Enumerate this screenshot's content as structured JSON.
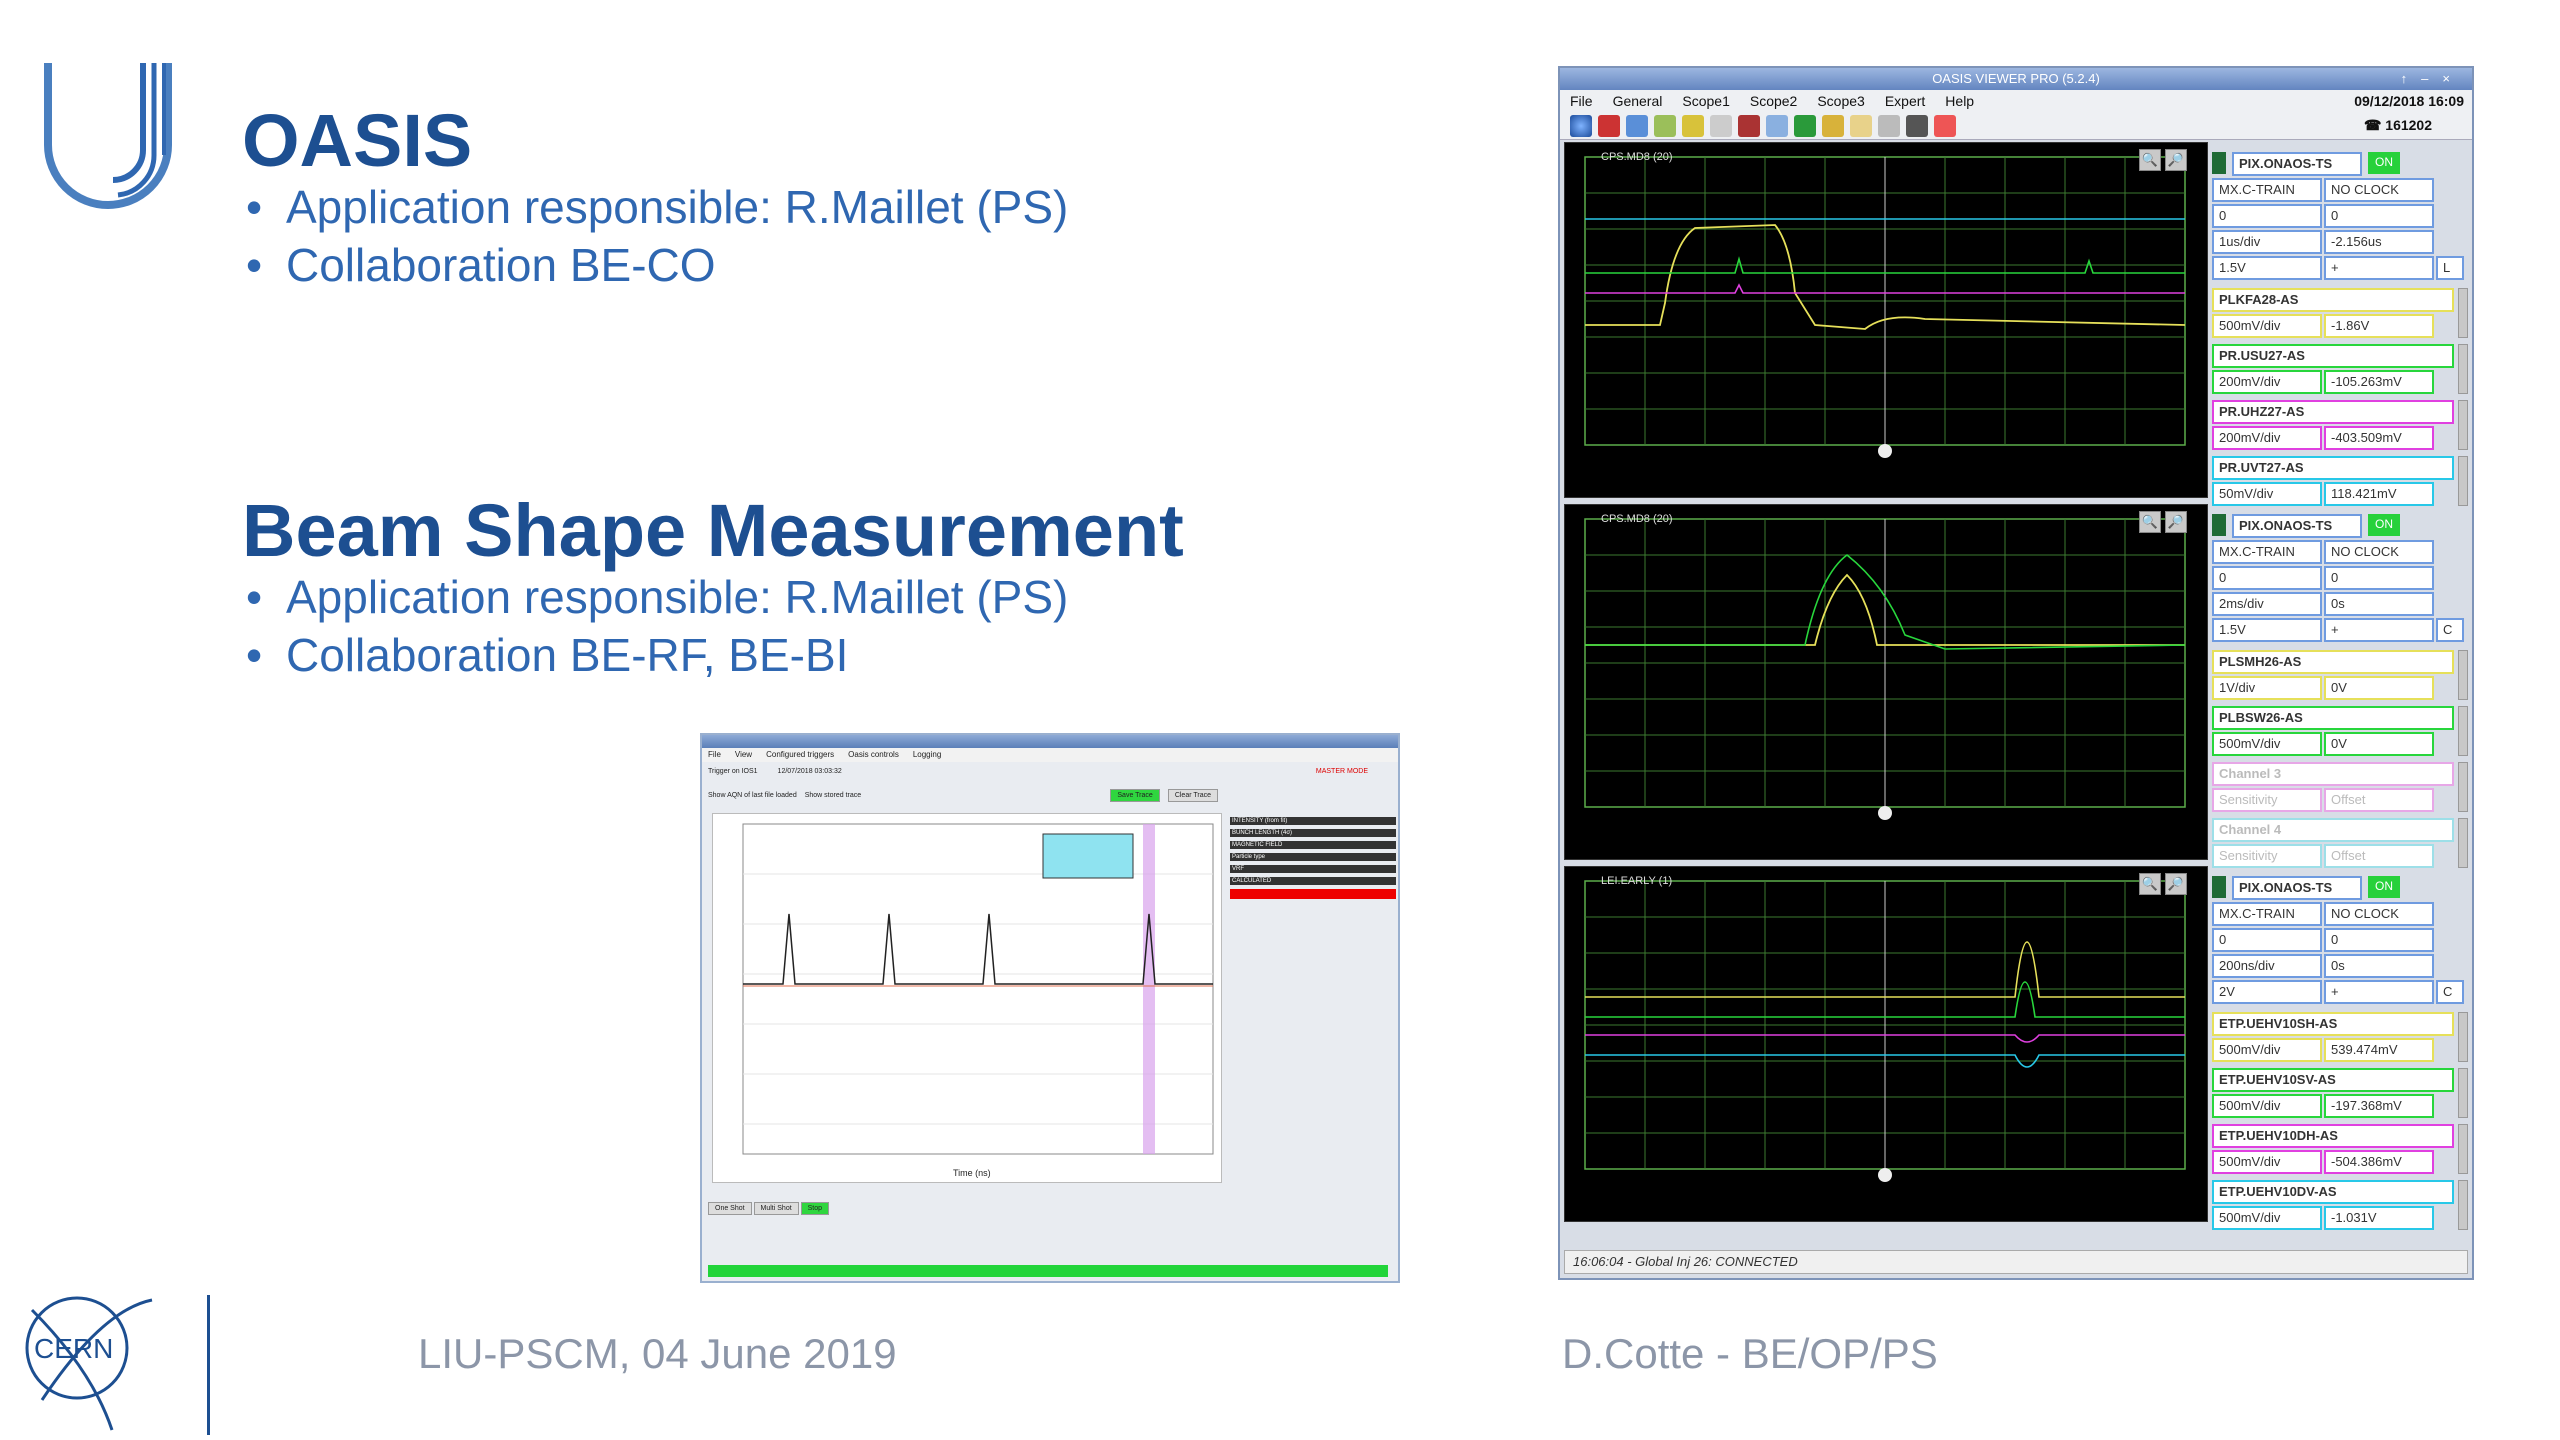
{
  "slide": {
    "section1": {
      "title": "OASIS",
      "bullets": [
        "Application responsible: R.Maillet (PS)",
        "Collaboration BE-CO"
      ]
    },
    "section2": {
      "title": "Beam Shape Measurement",
      "bullets": [
        "Application responsible: R.Maillet (PS)",
        "Collaboration BE-RF, BE-BI"
      ]
    },
    "footer": {
      "left": "LIU-PSCM, 04 June 2019",
      "right": "D.Cotte - BE/OP/PS",
      "cern_logo_text": "CERN"
    }
  },
  "mini_app": {
    "menu": [
      "File",
      "View",
      "Configured triggers",
      "Oasis controls",
      "Logging"
    ],
    "info": {
      "trigger": "Trigger on IOS1",
      "datetime": "12/07/2018 03:03:32",
      "mode": "MASTER MODE"
    },
    "buttons": {
      "save": "Save Trace",
      "clear": "Clear Trace",
      "one_shot": "One Shot",
      "multi": "Multi Shot",
      "stop": "Stop"
    },
    "checkboxes": [
      "Show AQN of last file loaded",
      "Show stored trace"
    ],
    "side_headers": [
      "INTENSITY (from fit)",
      "BUNCH LENGTH (4σ)",
      "MAGNETIC FIELD",
      "Particle type",
      "VRF",
      "CALCULATED"
    ],
    "xaxis_label": "Time (ns)",
    "colors": {
      "status": "#22d43a",
      "highlight": "#d9a3ec"
    }
  },
  "oasis": {
    "window_title": "OASIS VIEWER PRO (5.2.4)",
    "menu": [
      "File",
      "General",
      "Scope1",
      "Scope2",
      "Scope3",
      "Expert",
      "Help"
    ],
    "datetime": "09/12/2018 16:09",
    "phone": "☎ 161202",
    "status": "16:06:04 - Global Inj 26: CONNECTED",
    "panels": [
      {
        "scope_label": "CPS.MD8 (20)",
        "timing": {
          "name": "PIX.ONAOS-TS",
          "on": "ON",
          "mode": "MX.C-TRAIN",
          "clock": "NO CLOCK",
          "v1": "0",
          "v2": "0",
          "tdiv": "1us/div",
          "delay": "-2.156us",
          "level": "1.5V",
          "slope": "+",
          "coupling": "L"
        },
        "channels": [
          {
            "name": "PLKFA28-AS",
            "sens": "500mV/div",
            "offset": "-1.86V",
            "color": "#e6e05a"
          },
          {
            "name": "PR.USU27-AS",
            "sens": "200mV/div",
            "offset": "-105.263mV",
            "color": "#28d63c"
          },
          {
            "name": "PR.UHZ27-AS",
            "sens": "200mV/div",
            "offset": "-403.509mV",
            "color": "#e040e0"
          },
          {
            "name": "PR.UVT27-AS",
            "sens": "50mV/div",
            "offset": "118.421mV",
            "color": "#28c8e8"
          }
        ]
      },
      {
        "scope_label": "CPS.MD8 (20)",
        "timing": {
          "name": "PIX.ONAOS-TS",
          "on": "ON",
          "mode": "MX.C-TRAIN",
          "clock": "NO CLOCK",
          "v1": "0",
          "v2": "0",
          "tdiv": "2ms/div",
          "delay": "0s",
          "level": "1.5V",
          "slope": "+",
          "coupling": "C"
        },
        "channels": [
          {
            "name": "PLSMH26-AS",
            "sens": "1V/div",
            "offset": "0V",
            "color": "#e6e05a"
          },
          {
            "name": "PLBSW26-AS",
            "sens": "500mV/div",
            "offset": "0V",
            "color": "#28d63c"
          },
          {
            "name": "Channel 3",
            "sens": "Sensitivity",
            "offset": "Offset",
            "color": "#e7a7e7"
          },
          {
            "name": "Channel 4",
            "sens": "Sensitivity",
            "offset": "Offset",
            "color": "#9ddfe8"
          }
        ]
      },
      {
        "scope_label": "LEI.EARLY (1)",
        "timing": {
          "name": "PIX.ONAOS-TS",
          "on": "ON",
          "mode": "MX.C-TRAIN",
          "clock": "NO CLOCK",
          "v1": "0",
          "v2": "0",
          "tdiv": "200ns/div",
          "delay": "0s",
          "level": "2V",
          "slope": "+",
          "coupling": "C"
        },
        "channels": [
          {
            "name": "ETP.UEHV10SH-AS",
            "sens": "500mV/div",
            "offset": "539.474mV",
            "color": "#e6e05a"
          },
          {
            "name": "ETP.UEHV10SV-AS",
            "sens": "500mV/div",
            "offset": "-197.368mV",
            "color": "#28d63c"
          },
          {
            "name": "ETP.UEHV10DH-AS",
            "sens": "500mV/div",
            "offset": "-504.386mV",
            "color": "#e040e0"
          },
          {
            "name": "ETP.UEHV10DV-AS",
            "sens": "500mV/div",
            "offset": "-1.031V",
            "color": "#28c8e8"
          }
        ]
      }
    ]
  }
}
